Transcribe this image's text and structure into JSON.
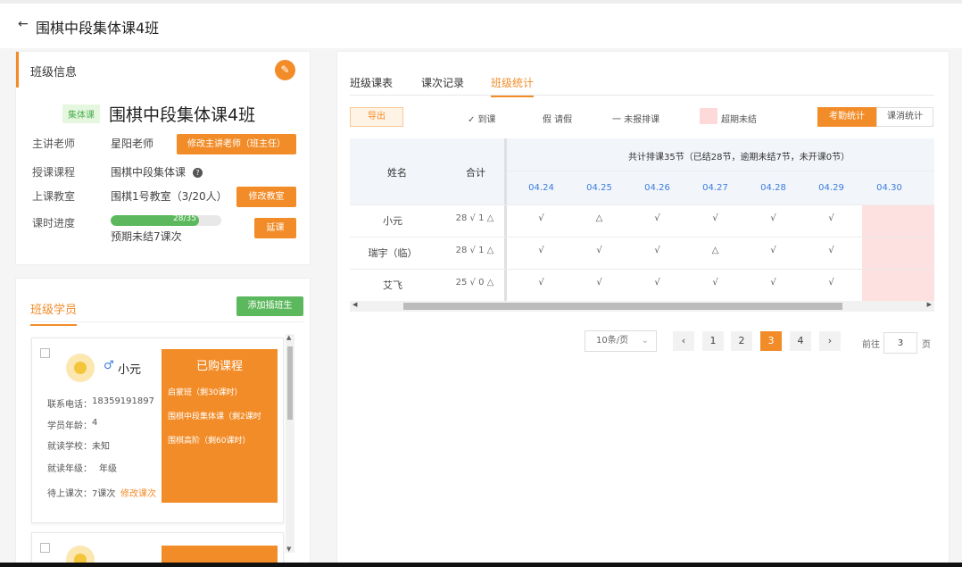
{
  "header": {
    "back_icon": "←",
    "title": "围棋中段集体课4班"
  },
  "class_info": {
    "section_title": "班级信息",
    "edit_icon": "✎",
    "type_tag": "集体课",
    "name": "围棋中段集体课4班",
    "teacher_label": "主讲老师",
    "teacher_value": "星阳老师",
    "change_teacher_btn": "修改主讲老师（班主任）",
    "course_label": "授课课程",
    "course_value": "围棋中段集体课",
    "classroom_label": "上课教室",
    "classroom_value": "围棋1号教室（3/20人）",
    "change_room_btn": "修改教室",
    "progress_label": "课时进度",
    "progress_text": "28/35",
    "progress_fraction": 0.8,
    "remaining_text": "预期未结7课次",
    "extend_btn": "延课"
  },
  "students": {
    "tab_label": "班级学员",
    "add_btn": "添加插班生",
    "cards": [
      {
        "gender_icon": "♂",
        "name": "小元",
        "phone_label": "联系电话：",
        "phone": "18359191897",
        "age_label": "学员年龄：",
        "age": "4",
        "school_label": "就读学校：",
        "school": "未知",
        "grade_label": "就读年级：",
        "grade": "年级",
        "pending_label": "待上课次：",
        "pending": "7课次",
        "edit_link": "修改课次",
        "purchased_title": "已购课程",
        "purchased": [
          "启蒙班（剩30课时）",
          "围棋中段集体课（剩2课时",
          "围棋高阶（剩60课时）"
        ]
      }
    ]
  },
  "right": {
    "tabs": [
      "班级课表",
      "课次记录",
      "班级统计"
    ],
    "export_btn": "导出",
    "legend": [
      "✓ 到课",
      "假 请假",
      "一 未报排课",
      "超期未结"
    ],
    "seg_on": "考勤统计",
    "seg_off": "课消统计",
    "table": {
      "col_name": "姓名",
      "col_total": "合计",
      "summary": "共计排课35节（已结28节，逾期未结7节，未开课0节）",
      "dates": [
        "04.24",
        "04.25",
        "04.26",
        "04.27",
        "04.28",
        "04.29",
        "04.30"
      ],
      "rows": [
        {
          "name": "小元",
          "total": "28 √ 1 △",
          "cells": [
            "√",
            "△",
            "√",
            "√",
            "√",
            "√",
            ""
          ]
        },
        {
          "name": "瑞宇（临）",
          "total": "28 √ 1 △",
          "cells": [
            "√",
            "√",
            "√",
            "△",
            "√",
            "√",
            ""
          ]
        },
        {
          "name": "艾飞",
          "total": "25 √ 0 △",
          "cells": [
            "√",
            "√",
            "√",
            "√",
            "√",
            "√",
            ""
          ]
        }
      ]
    },
    "pagination": {
      "page_size": "10条/页",
      "prev_icon": "‹",
      "next_icon": "›",
      "pages": [
        "1",
        "2",
        "3",
        "4"
      ],
      "current": "3",
      "goto_label": "前往",
      "goto_value": "3",
      "goto_suffix": "页"
    }
  },
  "colors": {
    "accent": "#f28c28",
    "green": "#5cb85c",
    "blue": "#3b7ddd",
    "pink": "#fde0e0"
  }
}
